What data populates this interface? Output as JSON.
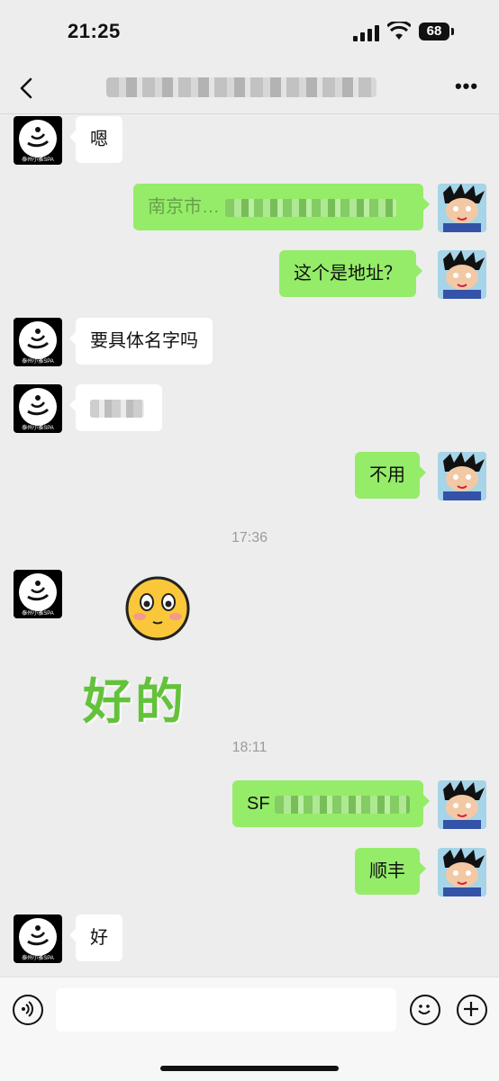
{
  "status_bar": {
    "time": "21:25",
    "battery": "68"
  },
  "nav": {
    "title_icon": "blurred-title",
    "more_label": "•••"
  },
  "contact": {
    "avatar_caption": "泰州小雅SPA"
  },
  "messages": [
    {
      "side": "in",
      "text": "嗯"
    },
    {
      "side": "out",
      "text": "南京市…",
      "blurred": true
    },
    {
      "side": "out",
      "text": "这个是地址？"
    },
    {
      "side": "in",
      "text": "要具体名字吗"
    },
    {
      "side": "in",
      "text": "",
      "blurred": true
    },
    {
      "side": "out",
      "text": "不用"
    },
    {
      "side": "in",
      "sticker": "好的"
    },
    {
      "side": "out",
      "text": "SF",
      "blurred": true
    },
    {
      "side": "out",
      "text": "顺丰"
    },
    {
      "side": "in",
      "text": "好"
    }
  ],
  "timestamps": [
    "17:36",
    "18:11"
  ],
  "input": {
    "placeholder": ""
  },
  "icons": [
    "back-chevron-icon",
    "more-icon",
    "voice-icon",
    "emoji-icon",
    "plus-icon"
  ]
}
